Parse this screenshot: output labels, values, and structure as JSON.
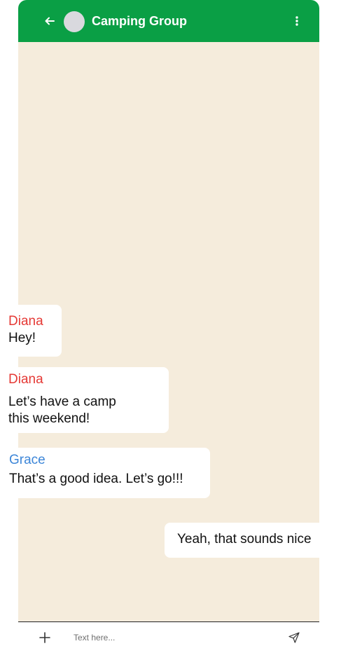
{
  "header": {
    "title": "Camping Group",
    "back_icon": "arrow-left-icon",
    "menu_icon": "more-vertical-icon",
    "color": "#0a9f45"
  },
  "chat": {
    "background": "#f5ecdc",
    "messages": [
      {
        "sender": "Diana",
        "sender_color": "#e53935",
        "text": "Hey!",
        "direction": "incoming"
      },
      {
        "sender": "Diana",
        "sender_color": "#e53935",
        "text": "Let’s have a camp\nthis weekend!",
        "direction": "incoming"
      },
      {
        "sender": "Grace",
        "sender_color": "#3d86d8",
        "text": "That’s a good idea. Let’s go!!!",
        "direction": "incoming"
      },
      {
        "sender": "",
        "text": "Yeah, that sounds nice",
        "direction": "outgoing"
      }
    ]
  },
  "composer": {
    "placeholder": "Text here...",
    "add_icon": "plus-icon",
    "send_icon": "send-icon"
  }
}
